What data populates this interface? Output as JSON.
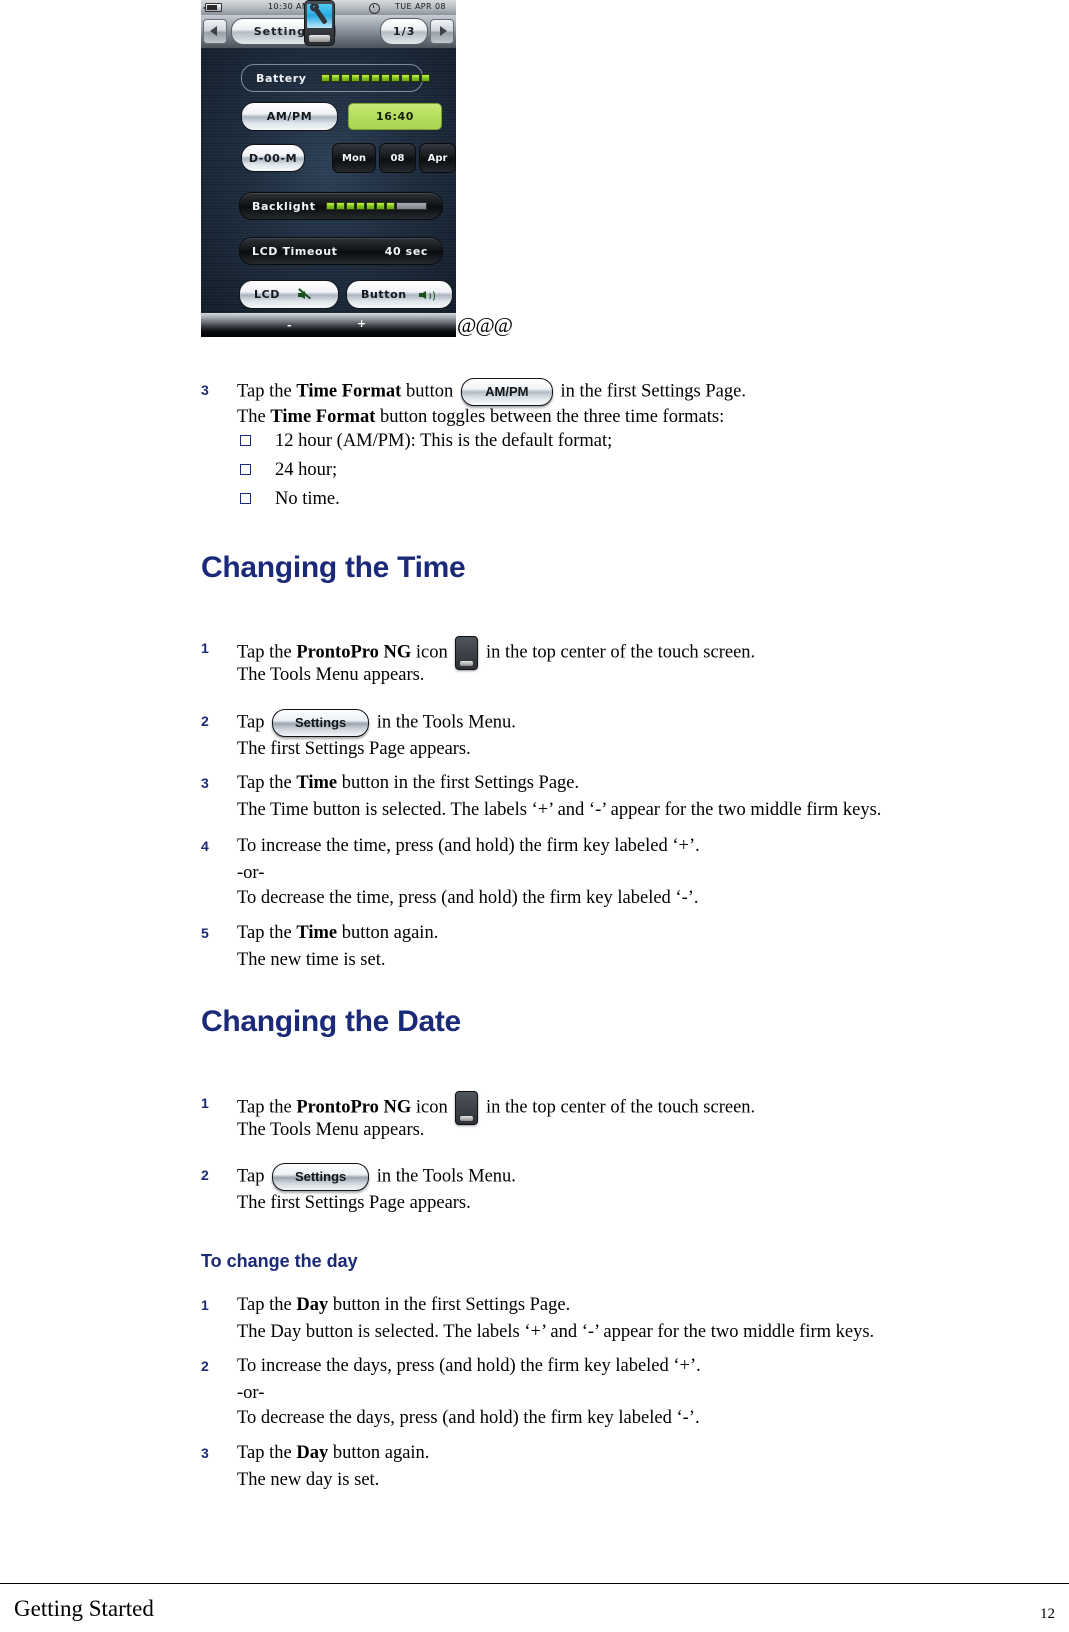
{
  "device": {
    "status_bar": {
      "time": "10:30 AM",
      "date": "TUE APR 08",
      "battery_icon": "battery-icon",
      "clock_icon": "clock-icon"
    },
    "nav": {
      "prev_label": "◀",
      "title": "Settings",
      "page_indicator": "1/3",
      "next_label": "▶",
      "center_icon": "prontopro-ng-icon"
    },
    "rows": {
      "battery_label": "Battery",
      "battery_segments_on": 11,
      "battery_segments_off": 0,
      "time_format_label": "AM/PM",
      "time_value": "16:40",
      "date_format_label": "D-00-M",
      "day_name": "Mon",
      "day_number": "08",
      "month_name": "Apr",
      "backlight_label": "Backlight",
      "backlight_segments_on": 7,
      "lcd_timeout_label": "LCD Timeout",
      "lcd_timeout_value": "40 sec",
      "lcd_button_label": "LCD",
      "lcd_button_icon": "speaker-muted-icon",
      "button_button_label": "Button",
      "button_button_icon": "speaker-on-icon"
    },
    "firm_keys": {
      "minus": "-",
      "plus": "+"
    },
    "marker": "@@@"
  },
  "content": {
    "step3_intro": {
      "num": "3",
      "pre": "Tap the ",
      "bold": "Time Format",
      "post": " button ",
      "button_label": "AM/PM",
      "tail": " in the first Settings Page.",
      "line2_pre": "The ",
      "line2_bold": "Time Format",
      "line2_post": " button toggles between the three time formats:"
    },
    "format_bullets": [
      "12 hour (AM/PM): This is the default format;",
      "24 hour;",
      "No time."
    ],
    "changing_time": {
      "heading": "Changing the Time",
      "steps": [
        {
          "num": "1",
          "pre": "Tap the ",
          "bold": "ProntoPro NG",
          "post": " icon ",
          "icon": "prontopro-ng-icon",
          "tail": " in the top center of the touch screen.",
          "sub": "The Tools Menu appears."
        },
        {
          "num": "2",
          "pre": "Tap ",
          "bold": "",
          "post": "",
          "button_label": "Settings",
          "tail": " in the Tools Menu.",
          "sub": "The first Settings Page appears."
        },
        {
          "num": "3",
          "pre": "Tap the ",
          "bold": "Time",
          "post": " button in the first Settings Page.",
          "sub": "The Time button is selected. The labels ‘+’ and ‘-’ appear for the two middle firm keys."
        },
        {
          "num": "4",
          "pre": "To increase the time, press (and hold) the firm key labeled ‘+’.",
          "or": "-or-",
          "sub": "To decrease the time, press (and hold) the firm key labeled ‘-’."
        },
        {
          "num": "5",
          "pre": "Tap the ",
          "bold": "Time",
          "post": " button again.",
          "sub": "The new time is set."
        }
      ]
    },
    "changing_date": {
      "heading": "Changing the Date",
      "steps": [
        {
          "num": "1",
          "pre": "Tap the ",
          "bold": "ProntoPro NG",
          "post": " icon ",
          "icon": "prontopro-ng-icon",
          "tail": " in the top center of the touch screen.",
          "sub": "The Tools Menu appears."
        },
        {
          "num": "2",
          "pre": "Tap ",
          "button_label": "Settings",
          "tail": " in the Tools Menu.",
          "sub": "The first Settings Page appears."
        }
      ],
      "subheading": "To change the day",
      "day_steps": [
        {
          "num": "1",
          "pre": "Tap the ",
          "bold": "Day",
          "post": " button in the first Settings Page.",
          "sub": "The Day button is selected. The labels ‘+’ and ‘-’ appear for the two middle firm keys."
        },
        {
          "num": "2",
          "pre": "To increase the days, press (and hold) the firm key labeled ‘+’.",
          "or": "-or-",
          "sub": "To decrease the days, press (and hold) the firm key labeled ‘-’."
        },
        {
          "num": "3",
          "pre": "Tap the ",
          "bold": "Day",
          "post": " button again.",
          "sub": "The new day is set."
        }
      ]
    }
  },
  "footer": {
    "left": "Getting Started",
    "page_number": "12"
  },
  "colors": {
    "heading": "#1b2a78",
    "accent_green": "#b4dd5c",
    "device_dark": "#16283c"
  }
}
